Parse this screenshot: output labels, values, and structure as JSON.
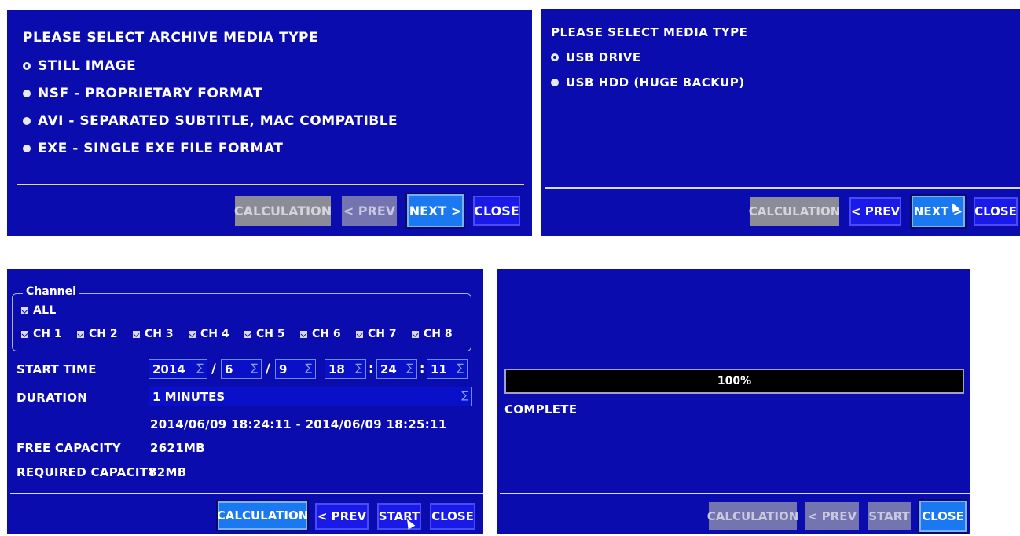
{
  "panel_archive": {
    "title": "PLEASE SELECT ARCHIVE MEDIA TYPE",
    "options": [
      {
        "label": "STILL IMAGE",
        "selected": true
      },
      {
        "label": "NSF - PROPRIETARY FORMAT",
        "selected": false
      },
      {
        "label": "AVI - SEPARATED SUBTITLE, MAC COMPATIBLE",
        "selected": false
      },
      {
        "label": "EXE - SINGLE EXE FILE FORMAT",
        "selected": false
      }
    ],
    "buttons": {
      "calculation": "CALCULATION",
      "prev": "< PREV",
      "next": "NEXT >",
      "close": "CLOSE"
    }
  },
  "panel_media": {
    "title": "PLEASE SELECT MEDIA TYPE",
    "options": [
      {
        "label": "USB DRIVE",
        "selected": true
      },
      {
        "label": "USB HDD (HUGE BACKUP)",
        "selected": false
      }
    ],
    "buttons": {
      "calculation": "CALCULATION",
      "prev": "< PREV",
      "next": "NEXT >",
      "close": "CLOSE"
    }
  },
  "panel_backup": {
    "channel_legend": "Channel",
    "all_label": "ALL",
    "channels": [
      "CH 1",
      "CH 2",
      "CH 3",
      "CH 4",
      "CH 5",
      "CH 6",
      "CH 7",
      "CH 8"
    ],
    "start_time_label": "START TIME",
    "start_time": {
      "year": "2014",
      "month": "6",
      "day": "9",
      "hour": "18",
      "minute": "24",
      "second": "11"
    },
    "date_sep": "/",
    "time_sep": ":",
    "duration_label": "DURATION",
    "duration_value": "1 MINUTES",
    "range_text": "2014/06/09 18:24:11 - 2014/06/09 18:25:11",
    "free_capacity_label": "FREE CAPACITY",
    "free_capacity_value": "2621MB",
    "required_capacity_label": "REQUIRED CAPACITY",
    "required_capacity_value": "82MB",
    "buttons": {
      "calculation": "CALCULATION",
      "prev": "< PREV",
      "start": "START",
      "close": "CLOSE"
    }
  },
  "panel_complete": {
    "progress_text": "100%",
    "progress_fraction": 1.0,
    "status": "COMPLETE",
    "buttons": {
      "calculation": "CALCULATION",
      "prev": "< PREV",
      "start": "START",
      "close": "CLOSE"
    }
  },
  "colors": {
    "panel_bg": "#0b0cae",
    "button_blue": "#1a1ae8",
    "button_focus": "#1a78f0",
    "button_disabled": "#8c8c98"
  },
  "icons": [
    "radio-selected-icon",
    "radio-unselected-icon",
    "checkbox-checked-icon",
    "spin-arrows-icon",
    "mouse-cursor-icon"
  ]
}
